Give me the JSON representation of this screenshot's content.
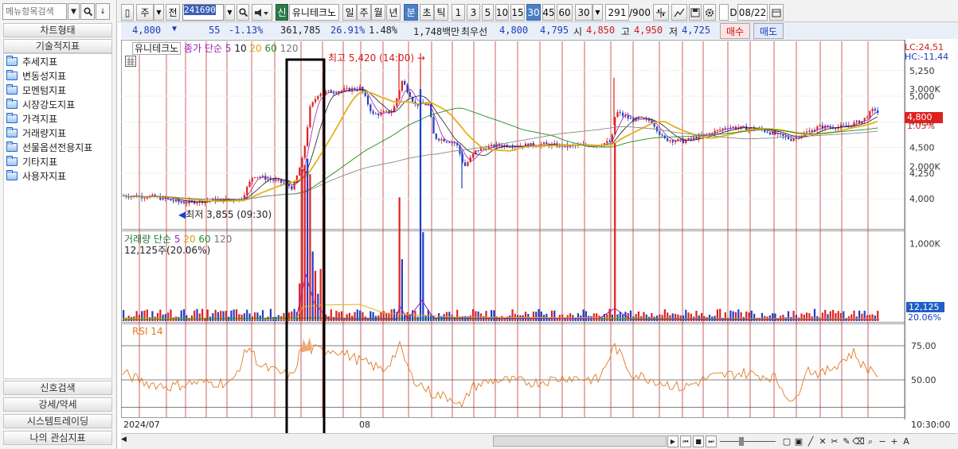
{
  "sidebar": {
    "search_placeholder": "메뉴항목검색",
    "chart_type_label": "차트형태",
    "tech_index_label": "기술적지표",
    "items": [
      "추세지표",
      "변동성지표",
      "모멘텀지표",
      "시장강도지표",
      "가격지표",
      "거래량지표",
      "선물옵션전용지표",
      "기타지표",
      "사용자지표"
    ],
    "bottom_buttons": [
      "신호검색",
      "강세/약세",
      "시스템트레이딩",
      "나의 관심지표"
    ]
  },
  "toolbar": {
    "period_select": "주",
    "prev_label": "전",
    "stock_code": "241690",
    "new_badge": "신",
    "stock_name": "유니테크노",
    "periods": [
      "일",
      "주",
      "월",
      "년",
      "분",
      "초",
      "틱"
    ],
    "active_period": "분",
    "intervals": [
      "1",
      "3",
      "5",
      "10",
      "15",
      "30",
      "45",
      "60"
    ],
    "active_interval": "30",
    "interval_select": "30",
    "count": "291",
    "count_total": "/900",
    "date_label": "D",
    "date_value": "08/22"
  },
  "quote": {
    "price": "4,800",
    "change": "55",
    "change_pct": "-1.13%",
    "volume": "361,785",
    "turnover_pct": "26.91%",
    "ratio": "1.48%",
    "amount": "1,748백만",
    "priority_label": "최우선",
    "ask": "4,800",
    "bid": "4,795",
    "open_label": "시",
    "open": "4,850",
    "high_label": "고",
    "high": "4,950",
    "low_label": "저",
    "low": "4,725",
    "buy_label": "매수",
    "sell_label": "매도"
  },
  "price_panel": {
    "name_label": "유니테크노",
    "ma_label": "종가 단순",
    "ma_periods": [
      "5",
      "10",
      "20",
      "60",
      "120"
    ],
    "ma_colors": [
      "#9d1fb6",
      "#1a1a1a",
      "#e2b21a",
      "#228b22",
      "#888888"
    ],
    "high_annotation": "최고 5,420 (14:00)",
    "low_annotation": "최저 3,855 (09:30)",
    "lc": "LC:24,51",
    "hc": "HC:-11,44",
    "price_tag": "4,800",
    "pct_tag": "1.05%",
    "y_ticks": [
      "5,250",
      "5,000",
      "4,750",
      "4,500",
      "4,250",
      "4,000"
    ],
    "y_tick_values": [
      5250,
      5000,
      4750,
      4500,
      4250,
      4000
    ]
  },
  "volume_panel": {
    "label": "거래량 단순",
    "ma_periods": [
      "5",
      "20",
      "60",
      "120"
    ],
    "current": "12,125주(20.06%)",
    "tag_value": "12,125",
    "tag_pct": "20.06%",
    "y_ticks": [
      "3,000K",
      "2,000K",
      "1,000K"
    ],
    "y_tick_values": [
      3000,
      2000,
      1000
    ]
  },
  "rsi_panel": {
    "label": "RSI 14",
    "y_ticks": [
      "75.00",
      "50.00"
    ],
    "y_tick_values": [
      75,
      50
    ]
  },
  "x_axis": {
    "start_label": "2024/07",
    "month_label": "08",
    "end_label": "10:30:00"
  },
  "colors": {
    "up": "#e02020",
    "down": "#1f3fc7",
    "grid_vertical": "#c23a3a",
    "selection_box": "#000000",
    "rsi_line": "#e07b22"
  },
  "chart_data": {
    "type": "candlestick",
    "interval": "30분",
    "y_range": [
      3855,
      5420
    ],
    "high": 5420,
    "low": 3855,
    "last_close": 4800,
    "rsi_range": [
      25,
      80
    ]
  }
}
